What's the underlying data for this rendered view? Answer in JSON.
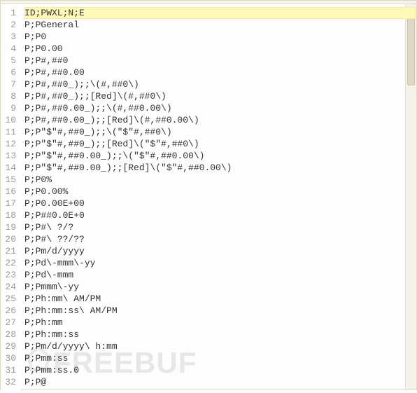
{
  "active_line": 1,
  "lines": [
    "ID;PWXL;N;E",
    "P;PGeneral",
    "P;P0",
    "P;P0.00",
    "P;P#,##0",
    "P;P#,##0.00",
    "P;P#,##0_);;\\(#,##0\\)",
    "P;P#,##0_);;[Red]\\(#,##0\\)",
    "P;P#,##0.00_);;\\(#,##0.00\\)",
    "P;P#,##0.00_);;[Red]\\(#,##0.00\\)",
    "P;P\"$\"#,##0_);;\\(\"$\"#,##0\\)",
    "P;P\"$\"#,##0_);;[Red]\\(\"$\"#,##0\\)",
    "P;P\"$\"#,##0.00_);;\\(\"$\"#,##0.00\\)",
    "P;P\"$\"#,##0.00_);;[Red]\\(\"$\"#,##0.00\\)",
    "P;P0%",
    "P;P0.00%",
    "P;P0.00E+00",
    "P;P##0.0E+0",
    "P;P#\\ ?/?",
    "P;P#\\ ??/??",
    "P;Pm/d/yyyy",
    "P;Pd\\-mmm\\-yy",
    "P;Pd\\-mmm",
    "P;Pmmm\\-yy",
    "P;Ph:mm\\ AM/PM",
    "P;Ph:mm:ss\\ AM/PM",
    "P;Ph:mm",
    "P;Ph:mm:ss",
    "P;Pm/d/yyyy\\ h:mm",
    "P;Pmm:ss",
    "P;Pmm:ss.0",
    "P;P@"
  ],
  "watermark": "FREEBUF"
}
